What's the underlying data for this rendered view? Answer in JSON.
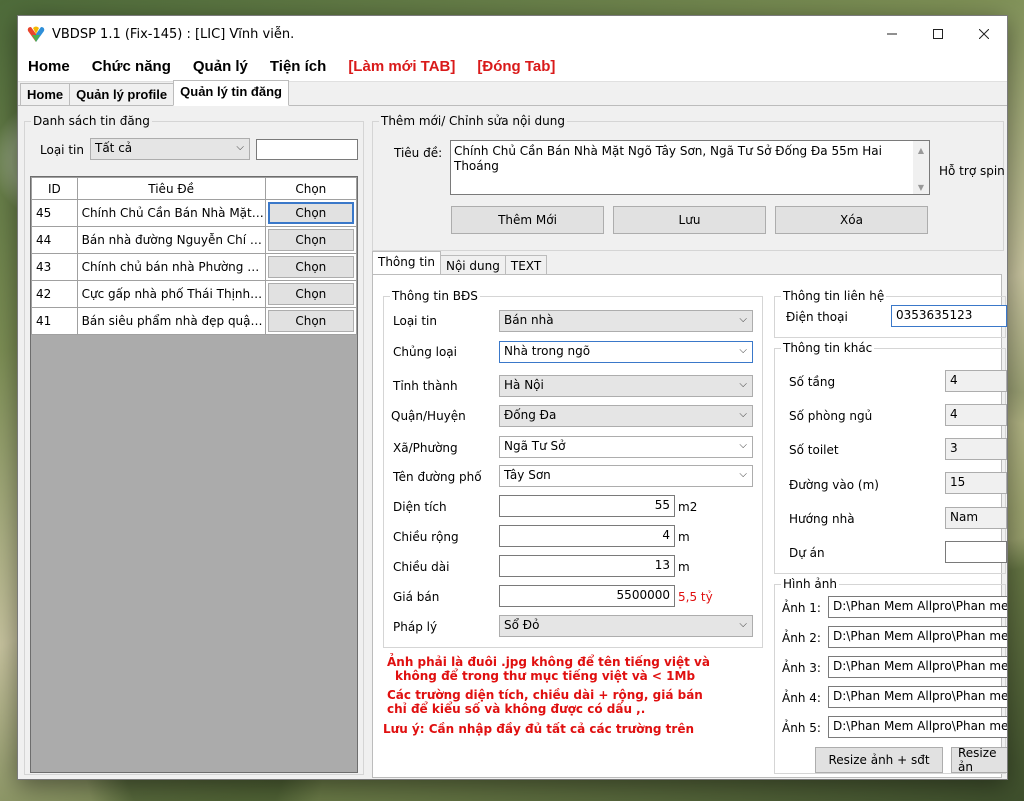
{
  "window": {
    "title": "VBDSP 1.1 (Fix-145) : [LIC] Vĩnh viễn."
  },
  "menu": {
    "items": [
      "Home",
      "Chức năng",
      "Quản lý",
      "Tiện ích",
      "[Làm mới TAB]",
      "[Đóng Tab]"
    ]
  },
  "tabs": [
    "Home",
    "Quản lý profile",
    "Quản lý tin đăng"
  ],
  "list_panel": {
    "title": "Danh sách tin đăng",
    "filter_label": "Loại tin",
    "filter_value": "Tất cả",
    "filter_text": "",
    "columns": [
      "ID",
      "Tiêu Đề",
      "Chọn"
    ],
    "rows": [
      {
        "id": "45",
        "title": "Chính Chủ Cần Bán Nhà Mặt ...",
        "action": "Chọn"
      },
      {
        "id": "44",
        "title": "Bán nhà đường Nguyễn Chí T...",
        "action": "Chọn"
      },
      {
        "id": "43",
        "title": "Chính chủ bán nhà Phường Lá...",
        "action": "Chọn"
      },
      {
        "id": "42",
        "title": "Cực gấp nhà phố Thái Thịnh t...",
        "action": "Chọn"
      },
      {
        "id": "41",
        "title": "Bán siêu phẩm nhà đẹp quận ...",
        "action": "Chọn"
      }
    ]
  },
  "editor": {
    "title": "Thêm mới/ Chỉnh sửa nội dung",
    "title_label": "Tiêu đề:",
    "title_value": "Chính Chủ Cần Bán Nhà Mặt Ngõ Tây Sơn, Ngã Tư Sở Đống Đa 55m Hai Thoáng",
    "spin_label": "Hỗ trợ spin",
    "add_button": "Thêm Mới",
    "save_button": "Lưu",
    "delete_button": "Xóa"
  },
  "subtabs": [
    "Thông tin",
    "Nội dung",
    "TEXT"
  ],
  "property": {
    "title": "Thông tin BĐS",
    "loai_tin_label": "Loại tin",
    "loai_tin": "Bán nhà",
    "chung_loai_label": "Chủng loại",
    "chung_loai": "Nhà trong ngõ",
    "tinh_thanh_label": "Tỉnh thành",
    "tinh_thanh": "Hà Nội",
    "quan_huyen_label": "Quận/Huyện",
    "quan_huyen": "Đống Đa",
    "xa_phuong_label": "Xã/Phường",
    "xa_phuong": "Ngã Tư Sở",
    "duong_pho_label": "Tên đường phố",
    "duong_pho": "Tây Sơn",
    "dien_tich_label": "Diện tích",
    "dien_tich": "55",
    "dien_tich_unit": "m2",
    "chieu_rong_label": "Chiều rộng",
    "chieu_rong": "4",
    "chieu_rong_unit": "m",
    "chieu_dai_label": "Chiều dài",
    "chieu_dai": "13",
    "chieu_dai_unit": "m",
    "gia_ban_label": "Giá bán",
    "gia_ban": "5500000",
    "gia_ban_hint": "5,5 tỷ",
    "phap_ly_label": "Pháp lý",
    "phap_ly": "Sổ Đỏ"
  },
  "notes": {
    "line1": "Ảnh phải là đuôi .jpg không để tên tiếng việt và",
    "line2": "không để trong thư mục tiếng việt và < 1Mb",
    "line3": "Các trường diện tích, chiều dài + rộng, giá bán",
    "line4": "chỉ để kiểu số và không được có dấu ,.",
    "line5": "Lưu ý: Cần nhập đầy đủ tất cả các trường trên"
  },
  "contact": {
    "title": "Thông tin liên hệ",
    "phone_label": "Điện thoại",
    "phone": "0353635123"
  },
  "other": {
    "title": "Thông tin khác",
    "so_tang_label": "Số tầng",
    "so_tang": "4",
    "so_phong_ngu_label": "Số phòng ngủ",
    "so_phong_ngu": "4",
    "so_toilet_label": "Số toilet",
    "so_toilet": "3",
    "duong_vao_label": "Đường vào (m)",
    "duong_vao": "15",
    "huong_nha_label": "Hướng nhà",
    "huong_nha": "Nam",
    "du_an_label": "Dự án",
    "du_an": ""
  },
  "images": {
    "title": "Hình ảnh",
    "rows": [
      {
        "label": "Ảnh 1:",
        "path": "D:\\Phan Mem Allpro\\Phan mem"
      },
      {
        "label": "Ảnh 2:",
        "path": "D:\\Phan Mem Allpro\\Phan mem"
      },
      {
        "label": "Ảnh 3:",
        "path": "D:\\Phan Mem Allpro\\Phan mem"
      },
      {
        "label": "Ảnh 4:",
        "path": "D:\\Phan Mem Allpro\\Phan mem"
      },
      {
        "label": "Ảnh 5:",
        "path": "D:\\Phan Mem Allpro\\Phan mem"
      }
    ],
    "resize_button": "Resize ảnh + sđt",
    "resize_button2": "Resize ản"
  },
  "colors": {
    "accent_red": "#d91a1a",
    "focus_blue": "#3a78c9"
  }
}
